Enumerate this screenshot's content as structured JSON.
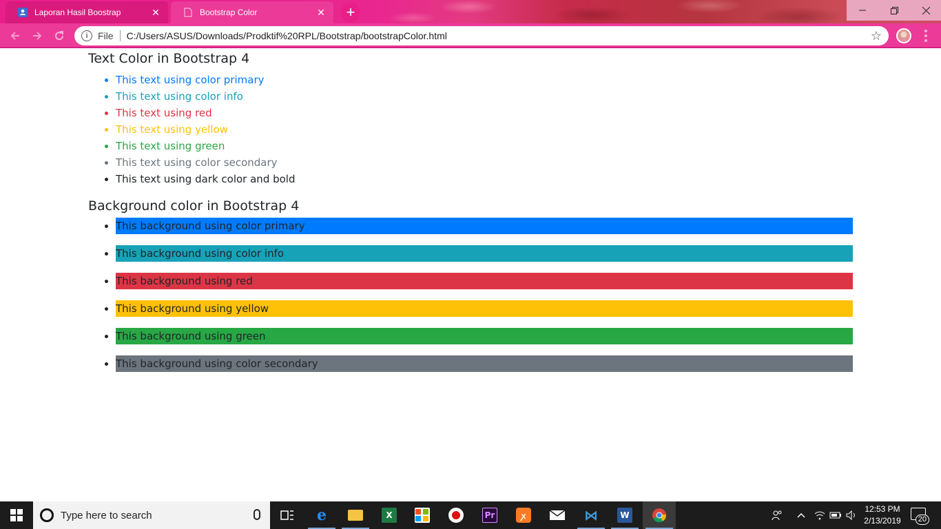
{
  "browser": {
    "tabs": [
      {
        "title": "Laporan Hasil Boostrap",
        "active": false
      },
      {
        "title": "Bootstrap Color",
        "active": true
      }
    ],
    "address": {
      "protocol": "File",
      "url": "C:/Users/ASUS/Downloads/Prodktif%20RPL/Bootstrap/bootstrapColor.html"
    },
    "accent_color": "#ec3a98"
  },
  "page": {
    "text_section": {
      "heading": "Text Color in Bootstrap 4",
      "items": [
        {
          "label": "This text using color primary",
          "color": "#007bff"
        },
        {
          "label": "This text using color info",
          "color": "#17a2b8"
        },
        {
          "label": "This text using red",
          "color": "#dc3545"
        },
        {
          "label": "This text using yellow",
          "color": "#ffc107"
        },
        {
          "label": "This text using green",
          "color": "#28a745"
        },
        {
          "label": "This text using color secondary",
          "color": "#6c757d"
        },
        {
          "label": "This text using dark color and bold",
          "color": "#343a40"
        }
      ]
    },
    "bg_section": {
      "heading": "Background color in Bootstrap 4",
      "items": [
        {
          "label": "This background using color primary",
          "color": "#007bff"
        },
        {
          "label": "This background using color info",
          "color": "#17a2b8"
        },
        {
          "label": "This background using red",
          "color": "#dc3545"
        },
        {
          "label": "This background using yellow",
          "color": "#ffc107"
        },
        {
          "label": "This background using green",
          "color": "#28a745"
        },
        {
          "label": "This background using color secondary",
          "color": "#6c757d"
        }
      ]
    }
  },
  "taskbar": {
    "search_placeholder": "Type here to search",
    "apps": [
      "task-view",
      "edge",
      "file-explorer",
      "excel",
      "store",
      "recorder",
      "premiere",
      "xampp",
      "mail",
      "vscode",
      "word",
      "chrome"
    ],
    "time": "12:53 PM",
    "date": "2/13/2019",
    "notification_count": "20"
  }
}
